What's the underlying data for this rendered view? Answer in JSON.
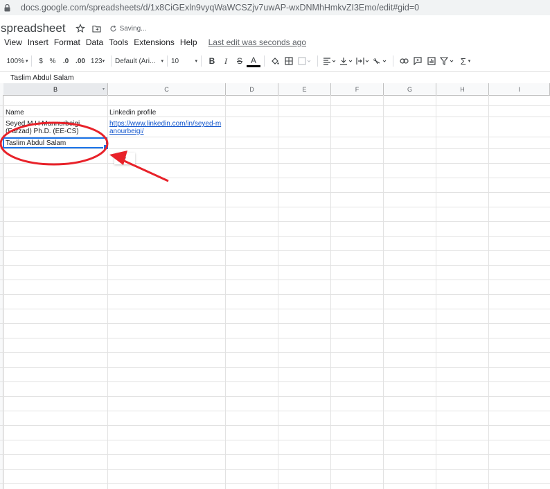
{
  "browser": {
    "url": "docs.google.com/spreadsheets/d/1x8CiGExln9vyqWaWCSZjv7uwAP-wxDNMhHmkvZI3Emo/edit#gid=0"
  },
  "doc": {
    "title": "spreadsheet",
    "status": "Saving..."
  },
  "menu": {
    "items": [
      "View",
      "Insert",
      "Format",
      "Data",
      "Tools",
      "Extensions",
      "Help"
    ],
    "last_edit": "Last edit was seconds ago"
  },
  "toolbar": {
    "zoom": "100%",
    "currency": "$",
    "percent": "%",
    "decrease_decimal": ".0",
    "increase_decimal": ".00",
    "more_formats": "123",
    "font": "Default (Ari...",
    "font_size": "10",
    "bold": "B",
    "italic": "I",
    "strike": "S",
    "text_color": "A",
    "sigma": "Σ"
  },
  "formula_bar": {
    "value": "Taslim Abdul Salam"
  },
  "grid": {
    "columns": [
      "B",
      "C",
      "D",
      "E",
      "F",
      "G",
      "H",
      "I"
    ],
    "selected_column": "B",
    "cells": {
      "b_name": "Name",
      "c_linkedin": "Linkedin profile",
      "b_person1_line1": "Seyed M H Mannurbeigi",
      "b_person1_line2": "(Farzad) Ph.D. (EE-CS)",
      "c_link_line1": "https://www.linkedin.com/in/seyed-m",
      "c_link_line2": "anourbeigi/",
      "b_editing": "Taslim Abdul Salam"
    }
  },
  "colors": {
    "accent": "#1a73e8",
    "annotation_red": "#e8222a",
    "link": "#1155cc"
  }
}
